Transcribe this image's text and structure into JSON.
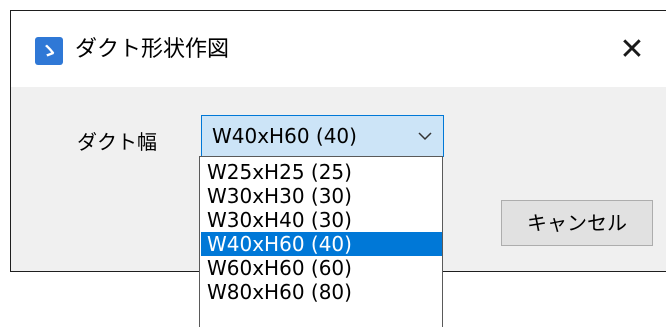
{
  "window": {
    "title": "ダクト形状作図",
    "app_icon": "app-logo-icon",
    "close_glyph": "✕"
  },
  "form": {
    "duct_width_label": "ダクト幅",
    "combo_value": "W40xH60 (40)",
    "chevron_icon": "chevron-down-icon"
  },
  "buttons": {
    "cancel_label": "キャンセル"
  },
  "dropdown": {
    "options": [
      "W25xH25 (25)",
      "W30xH30 (30)",
      "W30xH40 (30)",
      "W40xH60 (40)",
      "W60xH60 (60)",
      "W80xH60 (80)"
    ],
    "selected_index": 3
  },
  "colors": {
    "accent": "#0078d7",
    "combo_bg": "#cce4f7",
    "dialog_bg": "#f0f0f0",
    "app_icon_bg": "#2f78d6"
  }
}
